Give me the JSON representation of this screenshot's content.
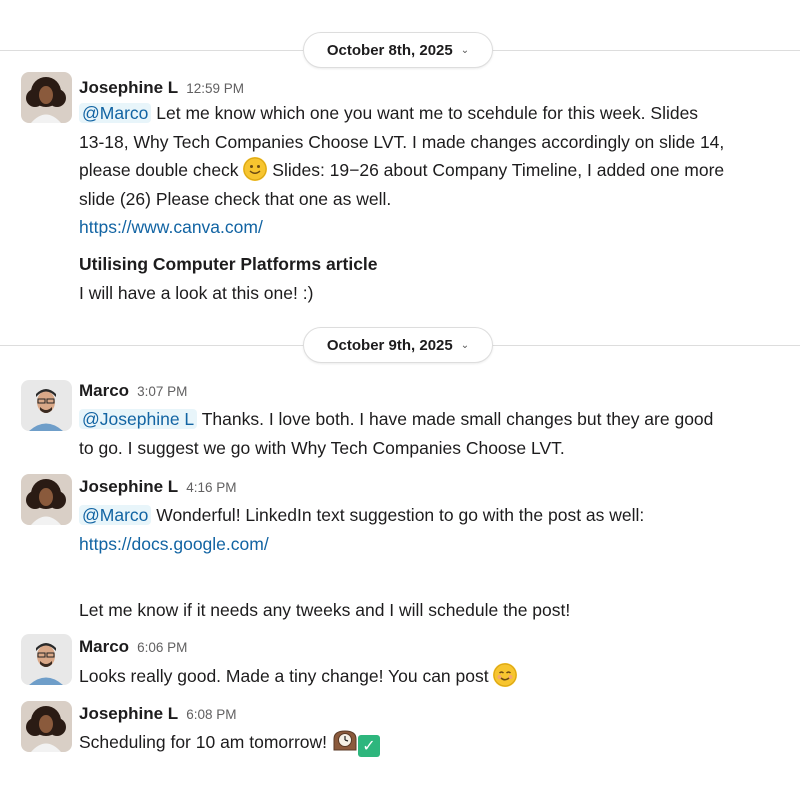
{
  "dividers": [
    {
      "date": "October 8th, 2025"
    },
    {
      "date": "October 9th, 2025"
    }
  ],
  "messages": [
    {
      "author": "Josephine L",
      "time": "12:59 PM",
      "mention": "@Marco",
      "text_1": " Let me know which one you want me to scehdule for this week. Slides",
      "text_2": "13-18, ",
      "title_1": "Why Tech Companies Choose LVT.",
      "text_3": "  I made changes accordingly on slide 14,",
      "text_4": "please double check ",
      "text_5": " Slides: 19−26 about ",
      "title_2": "Company Timeline",
      "text_6": ", I added one more",
      "text_7": "slide (26) Please check that one as well.",
      "link": "https://www.canva.com/"
    },
    {
      "heading": "Utilising Computer Platforms article",
      "text": "I will have a look at this one! :)"
    },
    {
      "author": "Marco",
      "time": "3:07 PM",
      "mention": "@Josephine L",
      "text_1": " Thanks. I love both. I have made small changes but they are good",
      "text_2": "to go. I suggest we go with ",
      "title": "Why Tech Companies Choose LVT."
    },
    {
      "author": "Josephine L",
      "time": "4:16 PM",
      "mention": "@Marco",
      "text_1": " Wonderful! LinkedIn text suggestion to go with the post as well:",
      "link": "https://docs.google.com/",
      "text_2": "Let me know if it needs any tweeks and I will schedule the post!"
    },
    {
      "author": "Marco",
      "time": "6:06 PM",
      "text": "Looks really good. Made a tiny change! You can post ",
      "emoji": "☺"
    },
    {
      "author": "Josephine L",
      "time": "6:08 PM",
      "text": "Scheduling for 10 am tomorrow! ",
      "emoji_check": "✓"
    }
  ],
  "colors": {
    "link": "#1264a3",
    "mention_bg": "#e8f5fa",
    "divider": "#dddddd",
    "check": "#2eb67d"
  }
}
